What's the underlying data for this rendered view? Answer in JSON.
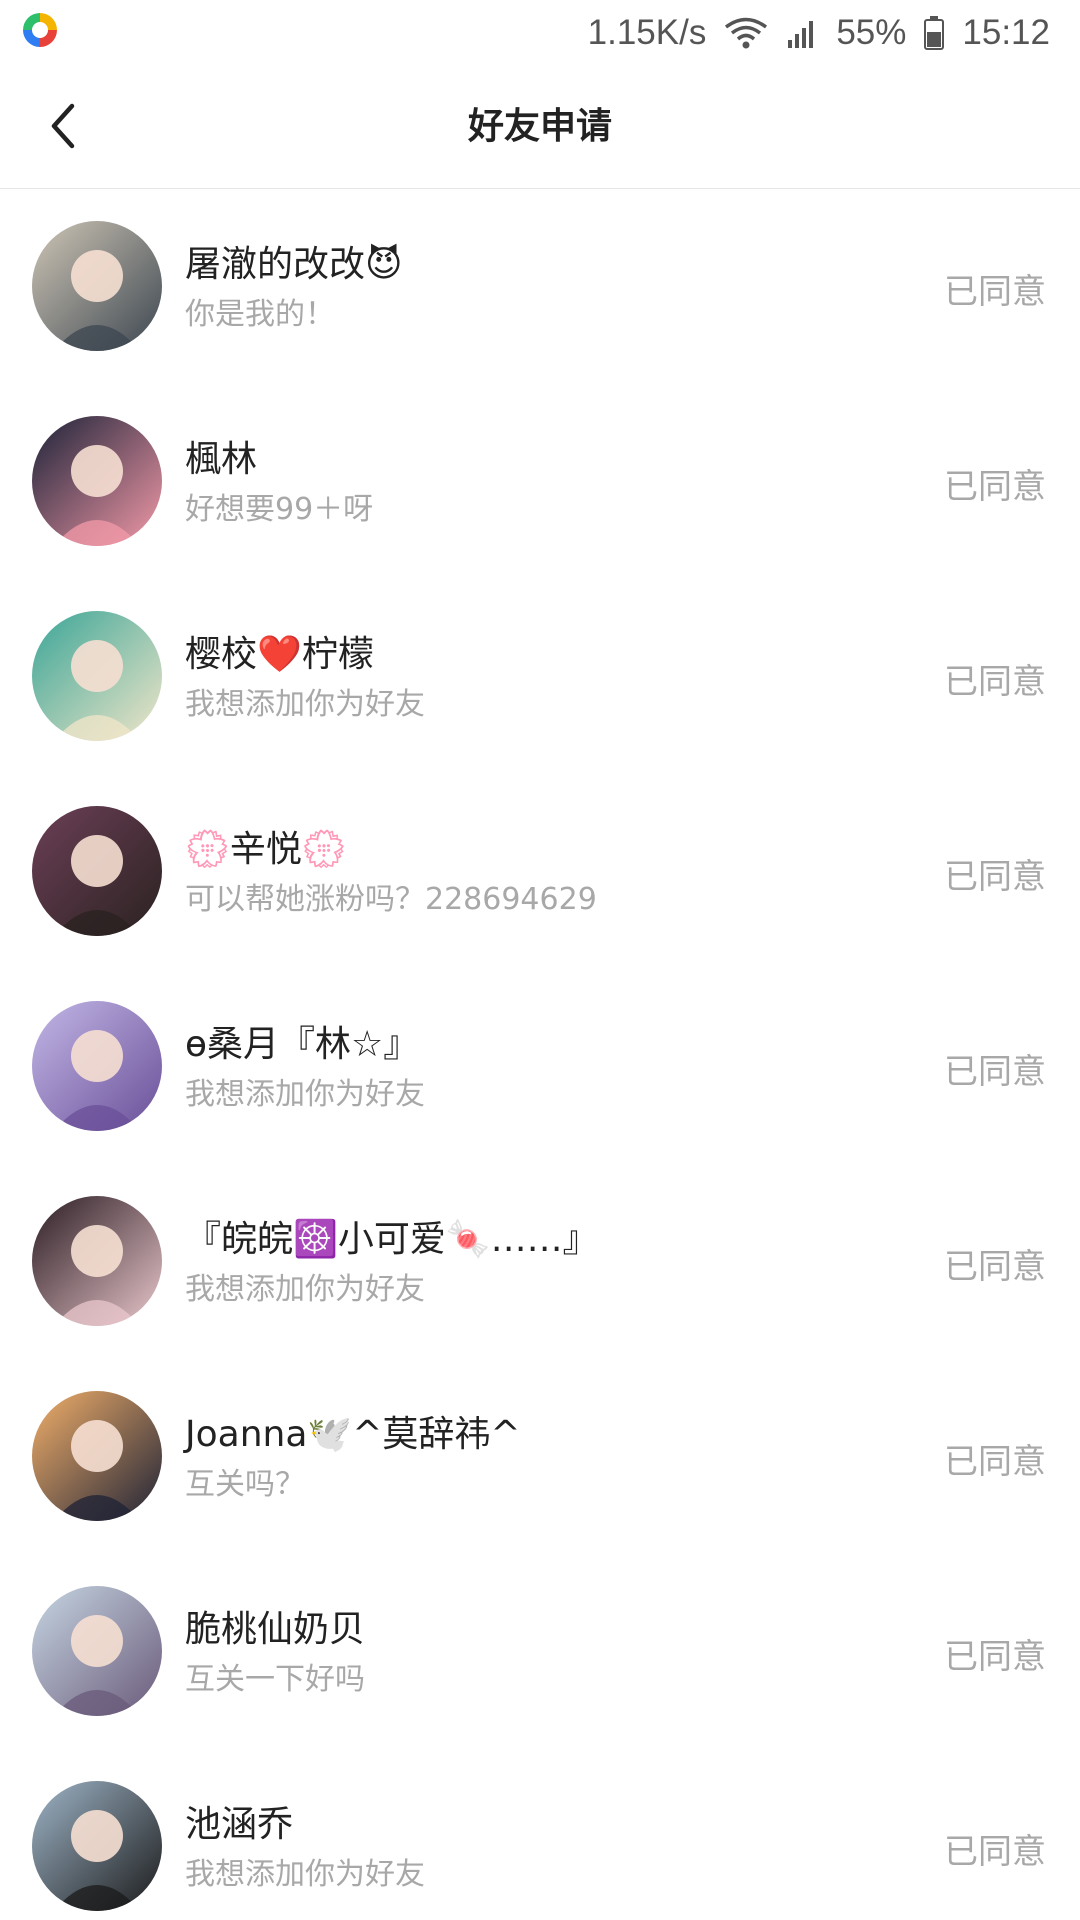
{
  "status_bar": {
    "network_speed": "1.15K/s",
    "battery": "55%",
    "time": "15:12",
    "icons": [
      "app-logo-icon",
      "wifi-icon",
      "signal-icon",
      "battery-icon"
    ]
  },
  "header": {
    "title": "好友申请",
    "back_icon": "chevron-left-icon"
  },
  "requests": [
    {
      "nickname": "屠澈的改改😈",
      "message": "你是我的！",
      "status": "已同意",
      "avatar_colors": [
        "#cfc6b6",
        "#3c4650"
      ]
    },
    {
      "nickname": "楓林",
      "message": "好想要99＋呀",
      "status": "已同意",
      "avatar_colors": [
        "#1c2238",
        "#f39aa8"
      ]
    },
    {
      "nickname": "樱校❤️柠檬",
      "message": "我想添加你为好友",
      "status": "已同意",
      "avatar_colors": [
        "#3aa597",
        "#f1e6c9"
      ]
    },
    {
      "nickname": "💮辛悦💮",
      "message": "可以帮她涨粉吗？228694629",
      "status": "已同意",
      "avatar_colors": [
        "#6c3f57",
        "#2a2220"
      ]
    },
    {
      "nickname": "ɵ桑月『林☆』",
      "message": "我想添加你为好友",
      "status": "已同意",
      "avatar_colors": [
        "#c2b7e6",
        "#6a4f98"
      ]
    },
    {
      "nickname": "『皖皖☸️小可爱🍬……』",
      "message": "我想添加你为好友",
      "status": "已同意",
      "avatar_colors": [
        "#2a1c22",
        "#e9c7cc"
      ]
    },
    {
      "nickname": "Joanna🕊️^莫辞祎^",
      "message": "互关吗？",
      "status": "已同意",
      "avatar_colors": [
        "#f3b06a",
        "#1e2236"
      ]
    },
    {
      "nickname": "脆桃仙奶贝",
      "message": "互关一下好吗",
      "status": "已同意",
      "avatar_colors": [
        "#c6d6e2",
        "#6a5a7a"
      ]
    },
    {
      "nickname": "池涵乔",
      "message": "我想添加你为好友",
      "status": "已同意",
      "avatar_colors": [
        "#9fb5c8",
        "#1a1a1a"
      ]
    }
  ]
}
